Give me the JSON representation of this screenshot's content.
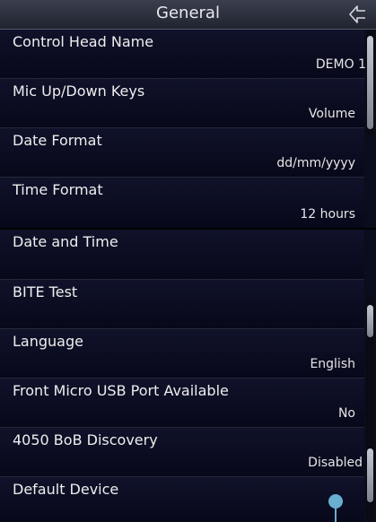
{
  "header": {
    "title": "General"
  },
  "settings_top": [
    {
      "label": "Control Head Name",
      "value": "DEMO 1"
    },
    {
      "label": "Mic Up/Down Keys",
      "value": "Volume"
    },
    {
      "label": "Date Format",
      "value": "dd/mm/yyyy"
    },
    {
      "label": "Time Format",
      "value": "12 hours"
    }
  ],
  "settings_bottom": [
    {
      "label": "Date and Time",
      "value": ""
    },
    {
      "label": "BITE Test",
      "value": ""
    },
    {
      "label": "Language",
      "value": "English"
    },
    {
      "label": "Front Micro USB Port Available",
      "value": "No"
    },
    {
      "label": "4050 BoB Discovery",
      "value": "Disabled"
    },
    {
      "label": "Default Device",
      "value": ""
    }
  ],
  "icons": {
    "back": "back-arrow-icon"
  }
}
